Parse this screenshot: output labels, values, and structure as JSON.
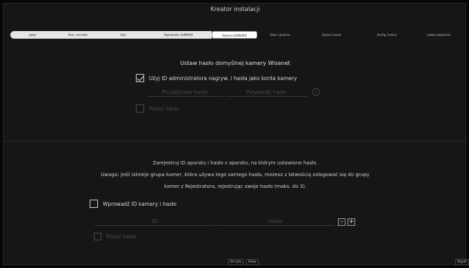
{
  "window": {
    "title": "Kreator instalacji"
  },
  "steps": [
    {
      "label": "Język",
      "state": "done"
    },
    {
      "label": "Pass. recorder",
      "state": "done"
    },
    {
      "label": "Sieć",
      "state": "done"
    },
    {
      "label": "Rejestrator SUMARIO",
      "state": "done"
    },
    {
      "label": "Kamera SUMARIO",
      "state": "current"
    },
    {
      "label": "Data i godzina",
      "state": "todo"
    },
    {
      "label": "Rejestr kamer",
      "state": "todo"
    },
    {
      "label": "Konfig. funkcji",
      "state": "todo"
    },
    {
      "label": "Łatwe połączenie",
      "state": "todo"
    }
  ],
  "camera_password": {
    "heading": "Ustaw hasło domyślnej kamery Wisenet",
    "use_admin_label": "Użyj ID administratora nagryw. i hasła jako konta kamery",
    "use_admin_checked": true,
    "initial_password_placeholder": "Początkowe hasło",
    "confirm_password_placeholder": "Potwierdź hasło",
    "info_icon_glyph": "i",
    "show_password_label": "Pokaż hasło",
    "show_password_checked": false
  },
  "register": {
    "line1": "Zarejestruj ID aparatu i hasło z aparatu, na którym ustawiono hasło.",
    "line2": "Uwaga: jeśli istnieje grupa kamer, która używa tego samego hasła, możesz z łatwością zalogować się do grupy",
    "line3": "kamer z Rejestratora, rejestrując swoje hasło (maks. do 3).",
    "enter_id_label": "Wprowadź ID kamery i hasło",
    "enter_id_checked": false,
    "id_placeholder": "ID",
    "password_placeholder": "Hasło",
    "minus_label": "-",
    "plus_label": "+",
    "show_password_label": "Pokaż hasło",
    "show_password_checked": false
  },
  "footer": {
    "back_label": "Do tyłu",
    "next_label": "Dalej",
    "exit_label": "Wyjdź"
  },
  "colors": {
    "background": "#161616",
    "step_done": "#e6e6e6",
    "step_current": "#ffffff",
    "text": "#d8d8d8",
    "disabled_text": "#4b4b4b"
  }
}
